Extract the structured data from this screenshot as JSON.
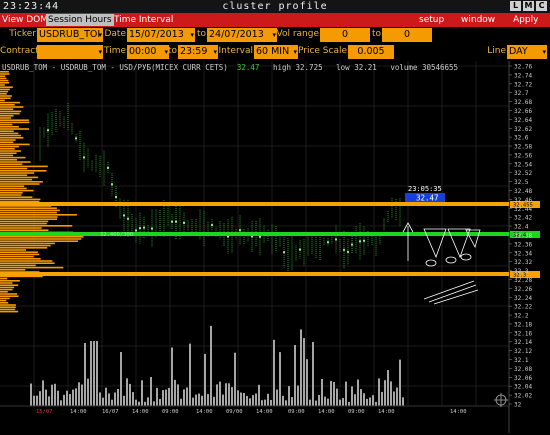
{
  "window": {
    "clock": "23:23:44",
    "title": "cluster profile",
    "buttons": [
      "L",
      "M",
      "C"
    ]
  },
  "menu": {
    "left_tabs": [
      "View DOM",
      "Session Hours",
      "Time Interval"
    ],
    "active_tab": "Session Hours",
    "right_tabs": [
      "setup",
      "window",
      "Apply"
    ]
  },
  "form": {
    "ticker_label": "Ticker",
    "ticker_value": "USDRUB_TOI",
    "date_label": "Date",
    "date_from": "15/07/2013",
    "date_to_label": "to",
    "date_to": "24/07/2013",
    "vol_range_label": "Vol range",
    "vol_from": "0",
    "vol_to_label": "to",
    "vol_to": "0",
    "contract_label": "Contract",
    "contract_value": "",
    "time_label": "Time",
    "time_from": "00:00",
    "time_to_label": "to",
    "time_to": "23:59",
    "interval_label": "Interval",
    "interval_value": "60 MIN",
    "price_scale_label": "Price Scale",
    "price_scale_value": "0.005",
    "line_label": "Line",
    "line_value": "DAY"
  },
  "chart_info": {
    "symbol": "USDRUB_TOM - USDRUB_TOM - USD/РУБ(MICEX CURR CETS)",
    "last": "32.47",
    "high_text": "high 32.725",
    "low_text": "low 32.21",
    "volume_text": "volume 30546655"
  },
  "price_axis": {
    "labels": [
      "32.76",
      "32.74",
      "32.72",
      "32.7",
      "32.68",
      "32.66",
      "32.64",
      "32.62",
      "32.6",
      "32.58",
      "32.56",
      "32.54",
      "32.52",
      "32.5",
      "32.48",
      "32.46",
      "32.44",
      "32.42",
      "32.4",
      "32.38",
      "32.36",
      "32.34",
      "32.32",
      "32.3",
      "32.28",
      "32.26",
      "32.24",
      "32.22",
      "32.2",
      "32.18",
      "32.16",
      "32.14",
      "32.12",
      "32.1",
      "32.08",
      "32.06",
      "32.04",
      "32.02",
      "32"
    ],
    "current_time": "23:05:35",
    "current_price": "32.47",
    "marker_high": "32.455",
    "marker_mid": "32.4",
    "marker_low": "32.3"
  },
  "levels": {
    "poc_label": "32.400/300",
    "upper_color": "#f5a300",
    "poc_color": "#1ed41e",
    "lower_color": "#f5a300"
  },
  "time_axis": {
    "labels": [
      "15/07",
      "14:00",
      "16/07",
      "14:00",
      "09:00",
      "14:00",
      "09/00",
      "14:00",
      "09:00",
      "14:00",
      "09:00",
      "14:00",
      "14:00"
    ]
  },
  "colors": {
    "menu_bg": "#cc1a1a",
    "field_bg": "#f59a00",
    "label": "#e8b54a",
    "candle": "#2f9d2f",
    "profile": "#f59a00",
    "volume": "#a6a6a6",
    "price_badge": "#1a3fd6"
  }
}
